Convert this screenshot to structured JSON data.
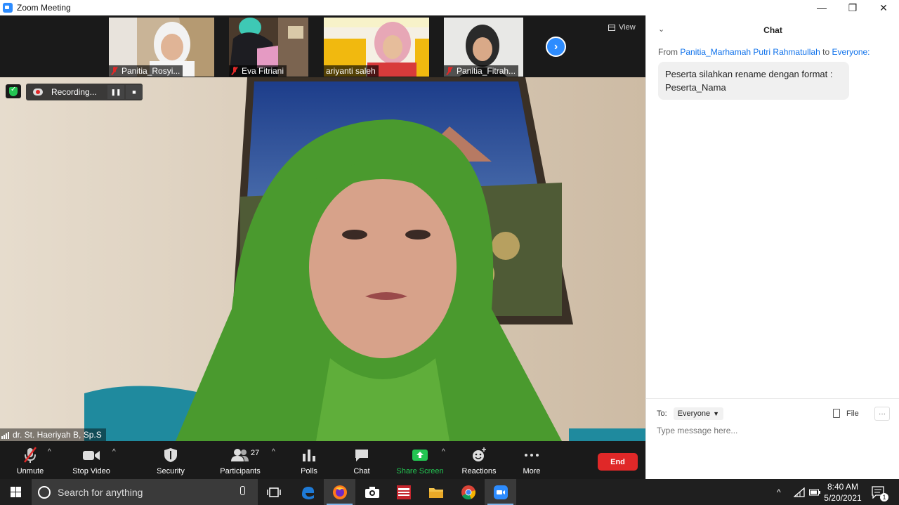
{
  "window": {
    "title": "Zoom Meeting",
    "minimize": "—",
    "restore": "❐",
    "close": "✕"
  },
  "thumbnails": [
    {
      "name": "Panitia_Rosyi...",
      "muted": true
    },
    {
      "name": "Eva Fitriani",
      "muted": true
    },
    {
      "name": "ariyanti saleh",
      "muted": false
    },
    {
      "name": "Panitia_Fitrah...",
      "muted": true
    }
  ],
  "gallery": {
    "next": "›",
    "view_label": "View"
  },
  "recording": {
    "status": "Recording...",
    "pause": "❚❚",
    "stop": "■"
  },
  "speaker": {
    "name": "dr. St. Haeriyah B, Sp.S"
  },
  "toolbar": {
    "unmute": "Unmute",
    "stop_video": "Stop Video",
    "security": "Security",
    "participants": "Participants",
    "participants_count": "27",
    "polls": "Polls",
    "chat": "Chat",
    "share_screen": "Share Screen",
    "reactions": "Reactions",
    "more": "More",
    "end": "End",
    "caret": "^",
    "share_color": "#23c552",
    "end_color": "#e02828"
  },
  "chat": {
    "title": "Chat",
    "collapse": "⌄",
    "from_prefix": "From",
    "sender": "Panitia_Marhamah Putri Rahmatullah",
    "to_word": "to",
    "recipient": "Everyone:",
    "message": "Peserta silahkan rename dengan format : Peserta_Nama",
    "to_label": "To:",
    "to_value": "Everyone",
    "file_label": "File",
    "more": "···",
    "input_placeholder": "Type message here..."
  },
  "taskbar": {
    "search_placeholder": "Search for anything",
    "time": "8:40 AM",
    "date": "5/20/2021",
    "notifications": "1",
    "tray_caret": "^"
  }
}
